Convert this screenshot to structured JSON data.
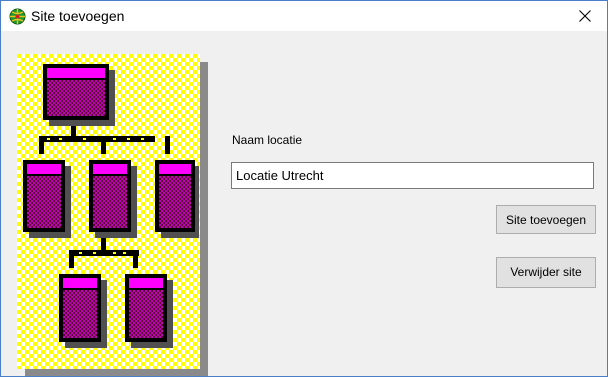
{
  "window": {
    "title": "Site toevoegen",
    "icons": {
      "app": "globe-network-icon",
      "close": "close-icon"
    }
  },
  "form": {
    "name_label": "Naam locatie",
    "name_value": "Locatie Utrecht",
    "add_button_label": "Site toevoegen",
    "remove_button_label": "Verwijder site"
  },
  "illustration": {
    "icon": "site-hierarchy-icon"
  },
  "colors": {
    "window_border": "#4a7fc8",
    "dialog_bg": "#f0f0f0",
    "checker_yellow": "#ffff00",
    "node_magenta": "#c000c0",
    "node_dark": "#600030"
  }
}
